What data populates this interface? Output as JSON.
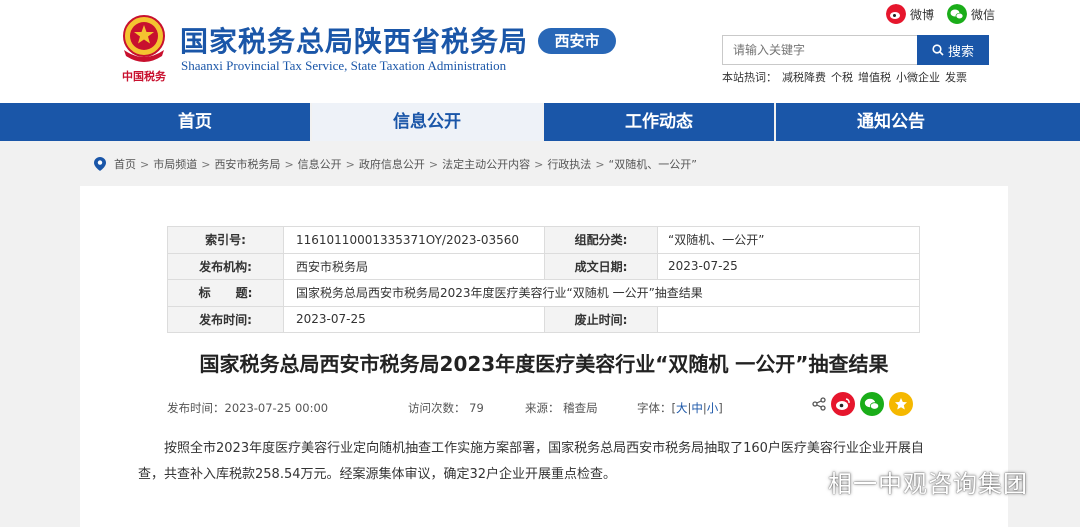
{
  "header": {
    "title": "国家税务总局陕西省税务局",
    "subtitle": "Shaanxi Provincial Tax Service, State Taxation Administration",
    "city_badge": "西安市",
    "emblem_text": "中国税务",
    "social": {
      "weibo": "微博",
      "weixin": "微信"
    },
    "search": {
      "placeholder": "请输入关键字",
      "button": "搜索"
    },
    "hotwords_label": "本站热词：",
    "hotwords": [
      "减税降费",
      "个税",
      "增值税",
      "小微企业",
      "发票"
    ]
  },
  "nav": {
    "items": [
      {
        "label": "首页"
      },
      {
        "label": "信息公开"
      },
      {
        "label": "工作动态"
      },
      {
        "label": "通知公告"
      }
    ],
    "active_index": 1
  },
  "breadcrumb": [
    "首页",
    "市局频道",
    "西安市税务局",
    "信息公开",
    "政府信息公开",
    "法定主动公开内容",
    "行政执法",
    "“双随机、一公开”"
  ],
  "meta": {
    "index_label": "索引号:",
    "index_value": "11610110001335371OY/2023-03560",
    "category_label": "组配分类:",
    "category_value": "“双随机、一公开”",
    "org_label": "发布机构:",
    "org_value": "西安市税务局",
    "date_label": "成文日期:",
    "date_value": "2023-07-25",
    "title_label": "标      题:",
    "title_value": "国家税务总局西安市税务局2023年度医疗美容行业“双随机 一公开”抽查结果",
    "pub_label": "发布时间:",
    "pub_value": "2023-07-25",
    "expire_label": "废止时间:",
    "expire_value": ""
  },
  "article": {
    "title": "国家税务总局西安市税务局2023年度医疗美容行业“双随机 一公开”抽查结果",
    "publish_time": "发布时间：2023-07-25 00:00",
    "visits": "访问次数：  79",
    "source": "来源：  稽查局",
    "font_label": "字体：",
    "font_large": "大",
    "font_medium": "中",
    "font_small": "小",
    "body": "按照全市2023年度医疗美容行业定向随机抽查工作实施方案部署，国家税务总局西安市税务局抽取了160户医疗美容行业企业开展自查，共查补入库税款258.54万元。经案源集体审议，确定32户企业开展重点检查。"
  },
  "watermark": "相一中观咨询集团",
  "colors": {
    "brand": "#1a56a8",
    "weibo": "#e6162d",
    "weixin": "#1aad19",
    "star": "#f5b800"
  }
}
